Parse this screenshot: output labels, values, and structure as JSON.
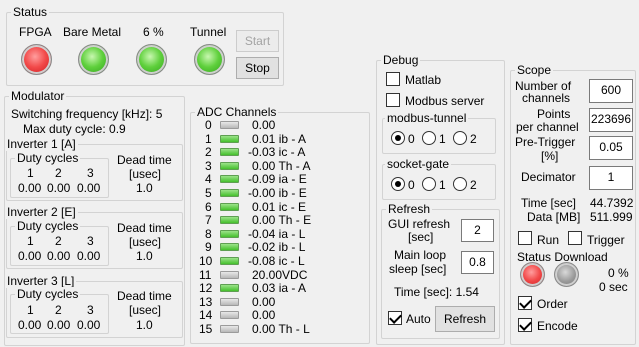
{
  "status": {
    "title": "Status",
    "indicators": [
      {
        "label": "FPGA",
        "state": "red"
      },
      {
        "label": "Bare Metal",
        "state": "green"
      },
      {
        "label": "6 %",
        "state": "green"
      },
      {
        "label": "Tunnel",
        "state": "green"
      }
    ],
    "start_label": "Start",
    "stop_label": "Stop"
  },
  "modulator": {
    "title": "Modulator",
    "switching_frequency": "Switching frequency [kHz]: 5",
    "max_duty_cycle": "Max duty cycle:  0.9",
    "inverters": [
      {
        "title": "Inverter 1 [A]",
        "duty_title": "Duty cycles",
        "headers": [
          "1",
          "2",
          "3"
        ],
        "values": [
          "0.00",
          "0.00",
          "0.00"
        ],
        "dead_time_label_1": "Dead time",
        "dead_time_label_2": "[usec]",
        "dead_time": "1.0"
      },
      {
        "title": "Inverter 2 [E]",
        "duty_title": "Duty cycles",
        "headers": [
          "1",
          "2",
          "3"
        ],
        "values": [
          "0.00",
          "0.00",
          "0.00"
        ],
        "dead_time_label_1": "Dead time",
        "dead_time_label_2": "[usec]",
        "dead_time": "1.0"
      },
      {
        "title": "Inverter 3 [L]",
        "duty_title": "Duty cycles",
        "headers": [
          "1",
          "2",
          "3"
        ],
        "values": [
          "0.00",
          "0.00",
          "0.00"
        ],
        "dead_time_label_1": "Dead time",
        "dead_time_label_2": "[usec]",
        "dead_time": "1.0"
      }
    ]
  },
  "adc": {
    "title": "ADC Channels",
    "channels": [
      {
        "index": "0",
        "text": "0.00",
        "active": false
      },
      {
        "index": "1",
        "text": "0.01 ib - A",
        "active": true
      },
      {
        "index": "2",
        "text": "-0.03 ic - A",
        "active": true
      },
      {
        "index": "3",
        "text": "0.00 Th - A",
        "active": true
      },
      {
        "index": "4",
        "text": "-0.09 ia - E",
        "active": true
      },
      {
        "index": "5",
        "text": "-0.00 ib - E",
        "active": true
      },
      {
        "index": "6",
        "text": "0.01 ic - E",
        "active": true
      },
      {
        "index": "7",
        "text": "0.00 Th - E",
        "active": true
      },
      {
        "index": "8",
        "text": "-0.04 ia - L",
        "active": true
      },
      {
        "index": "9",
        "text": "-0.02 ib - L",
        "active": true
      },
      {
        "index": "10",
        "text": "-0.08 ic - L",
        "active": true
      },
      {
        "index": "11",
        "text": "20.00VDC",
        "active": false
      },
      {
        "index": "12",
        "text": "0.03 ia - A",
        "active": true
      },
      {
        "index": "13",
        "text": "0.00",
        "active": false
      },
      {
        "index": "14",
        "text": "0.00",
        "active": false
      },
      {
        "index": "15",
        "text": "0.00 Th - L",
        "active": false
      }
    ]
  },
  "debug": {
    "title": "Debug",
    "matlab_label": "Matlab",
    "matlab_checked": false,
    "modbus_server_label": "Modbus server",
    "modbus_server_checked": false,
    "modbus_tunnel": {
      "title": "modbus-tunnel",
      "options": [
        "0",
        "1",
        "2"
      ],
      "selected": 0
    },
    "socket_gate": {
      "title": "socket-gate",
      "options": [
        "0",
        "1",
        "2"
      ],
      "selected": 0
    }
  },
  "refresh": {
    "title": "Refresh",
    "gui_refresh_label_1": "GUI refresh",
    "gui_refresh_label_2": "[sec]",
    "gui_refresh_value": "2",
    "main_loop_label_1": "Main loop",
    "main_loop_label_2": "sleep [sec]",
    "main_loop_value": "0.8",
    "time_text": "Time [sec]:  1.54",
    "auto_label": "Auto",
    "auto_checked": true,
    "refresh_button": "Refresh"
  },
  "scope": {
    "title": "Scope",
    "num_channels_label_1": "Number of",
    "num_channels_label_2": "channels",
    "num_channels_value": "600",
    "points_label_1": "Points",
    "points_label_2": "per channel",
    "points_value": "223696",
    "pretrigger_label_1": "Pre-Trigger",
    "pretrigger_label_2": "[%]",
    "pretrigger_value": "0.05",
    "decimator_label": "Decimator",
    "decimator_value": "1",
    "time_label": "Time [sec]",
    "time_value": "44.7392",
    "data_label": "Data [MB]",
    "data_value": "511.999",
    "run_label": "Run",
    "run_checked": false,
    "trigger_label": "Trigger",
    "trigger_checked": false,
    "status_download_title": "Status Download",
    "download_percent": "0 %",
    "download_sec": "0 sec",
    "order_label": "Order",
    "order_checked": true,
    "encode_label": "Encode",
    "encode_checked": true
  }
}
